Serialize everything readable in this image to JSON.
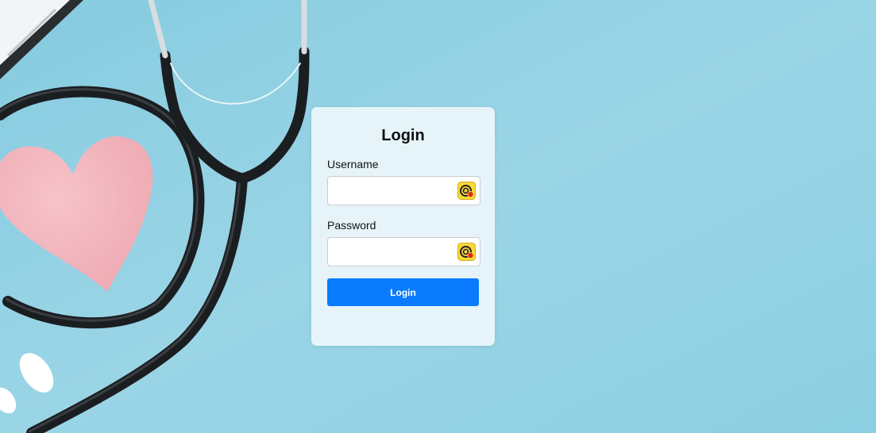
{
  "colors": {
    "background": "#8fd0e3",
    "button": "#0a7bfd",
    "card": "#ecf6fb",
    "heart": "#f5b9c0",
    "tube": "#1b1e21"
  },
  "login": {
    "title": "Login",
    "username_label": "Username",
    "username_value": "",
    "password_label": "Password",
    "password_value": "",
    "button_label": "Login",
    "field_icon": "password-manager-icon"
  }
}
